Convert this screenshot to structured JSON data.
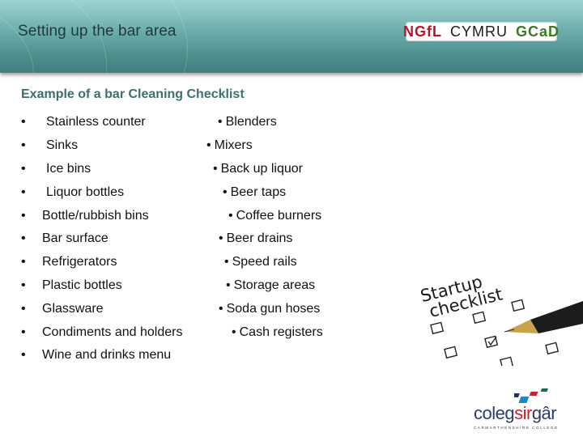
{
  "header": {
    "title": "Setting up the bar area",
    "logo": {
      "part1": "NGfL",
      "part2": "CYMRU",
      "part3": "GCaD"
    }
  },
  "content": {
    "heading": "Example of a bar  Cleaning Checklist",
    "left_bullet": "•",
    "right_bullet": "•",
    "left_items": [
      "Stainless counter",
      "Sinks",
      "Ice bins",
      "Liquor bottles",
      "Bottle/rubbish bins",
      "Bar surface",
      "Refrigerators",
      "Plastic bottles",
      "Glassware",
      "Condiments and holders",
      "Wine and drinks menu"
    ],
    "right_items": [
      "Blenders",
      "Mixers",
      "Back up liquor",
      "Beer taps",
      "Coffee burners",
      "Beer drains",
      "Speed rails",
      "Storage areas",
      "Soda gun hoses",
      "Cash registers"
    ]
  },
  "image": {
    "caption_line1": "Startup",
    "caption_line2": "checklist"
  },
  "footer_logo": {
    "name_part1": "coleg",
    "name_part2": "sir",
    "name_part3": "gâr",
    "subtitle": "CARMARTHENSHIRE COLLEGE"
  }
}
